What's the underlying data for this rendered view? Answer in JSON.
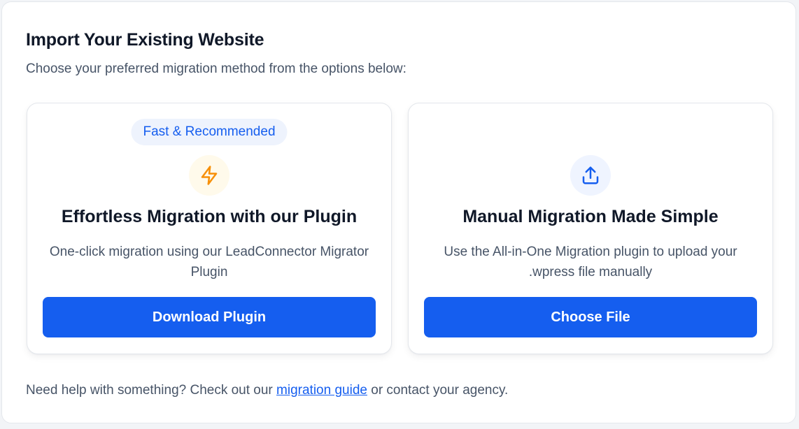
{
  "header": {
    "title": "Import Your Existing Website",
    "subtitle": "Choose your preferred migration method from the options below:"
  },
  "cards": [
    {
      "badge": "Fast & Recommended",
      "icon": "lightning-icon",
      "title": "Effortless Migration with our Plugin",
      "description": "One-click migration using our LeadConnector Migrator Plugin",
      "button_label": "Download Plugin"
    },
    {
      "icon": "upload-icon",
      "title": "Manual Migration Made Simple",
      "description": "Use the All-in-One Migration plugin to upload your .wpress file manually",
      "button_label": "Choose File"
    }
  ],
  "footer": {
    "prefix": "Need help with something? Check out our",
    "link_text": "migration guide",
    "suffix": "or contact your agency."
  },
  "colors": {
    "accent": "#155eef",
    "badge_bg": "#eef3fd",
    "lightning": "#f79009",
    "text_primary": "#101828",
    "text_secondary": "#475467"
  }
}
